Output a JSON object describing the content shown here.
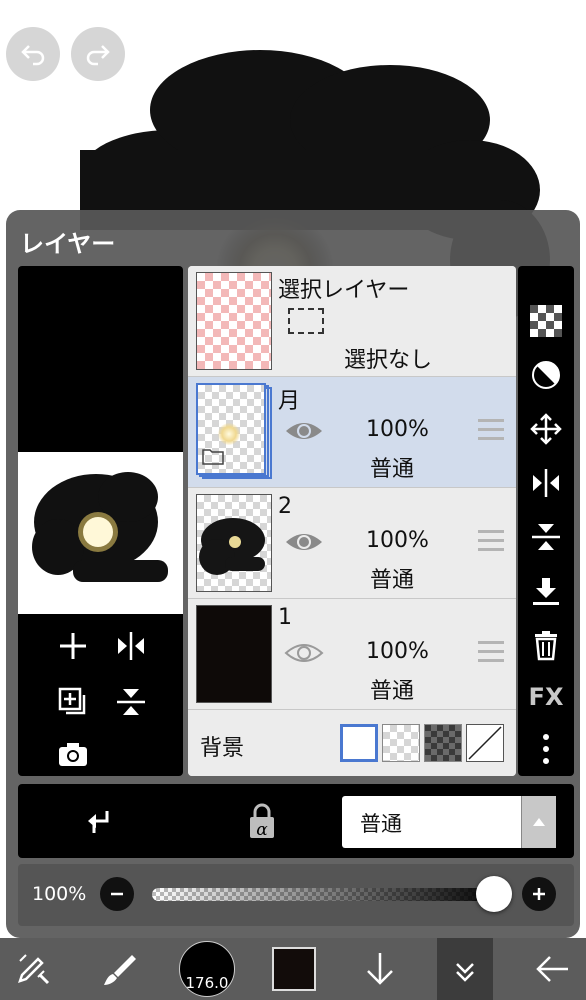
{
  "panel": {
    "title": "レイヤー"
  },
  "selection_layer": {
    "name": "選択レイヤー",
    "status": "選択なし"
  },
  "layers": [
    {
      "name": "月",
      "opacity": "100%",
      "blend": "普通"
    },
    {
      "name": "2",
      "opacity": "100%",
      "blend": "普通"
    },
    {
      "name": "1",
      "opacity": "100%",
      "blend": "普通"
    }
  ],
  "background": {
    "label": "背景"
  },
  "right_tools": {
    "fx_label": "FX"
  },
  "blend_mode": {
    "selected": "普通"
  },
  "opacity_control": {
    "value_label": "100%",
    "value": 1.0
  },
  "bottom_bar": {
    "brush_size": "176.0"
  },
  "colors": {
    "accent": "#4a78d0",
    "selected_row": "#d2dcec",
    "panel": "#585858"
  }
}
